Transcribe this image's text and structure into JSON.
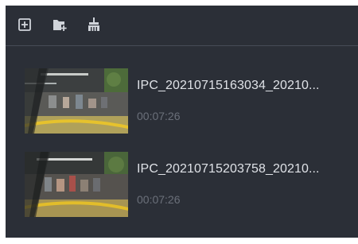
{
  "toolbar": {
    "buttons": [
      {
        "icon": "add-box-icon"
      },
      {
        "icon": "add-folder-icon"
      },
      {
        "icon": "broom-icon"
      }
    ]
  },
  "files": [
    {
      "name": "IPC_20210715163034_20210...",
      "duration": "00:07:26"
    },
    {
      "name": "IPC_20210715203758_20210...",
      "duration": "00:07:26"
    }
  ],
  "colors": {
    "panel_bg": "#2b2f37",
    "title_text": "#dfe2e7",
    "duration_text": "#6b707a",
    "icon": "#d0d4da"
  }
}
